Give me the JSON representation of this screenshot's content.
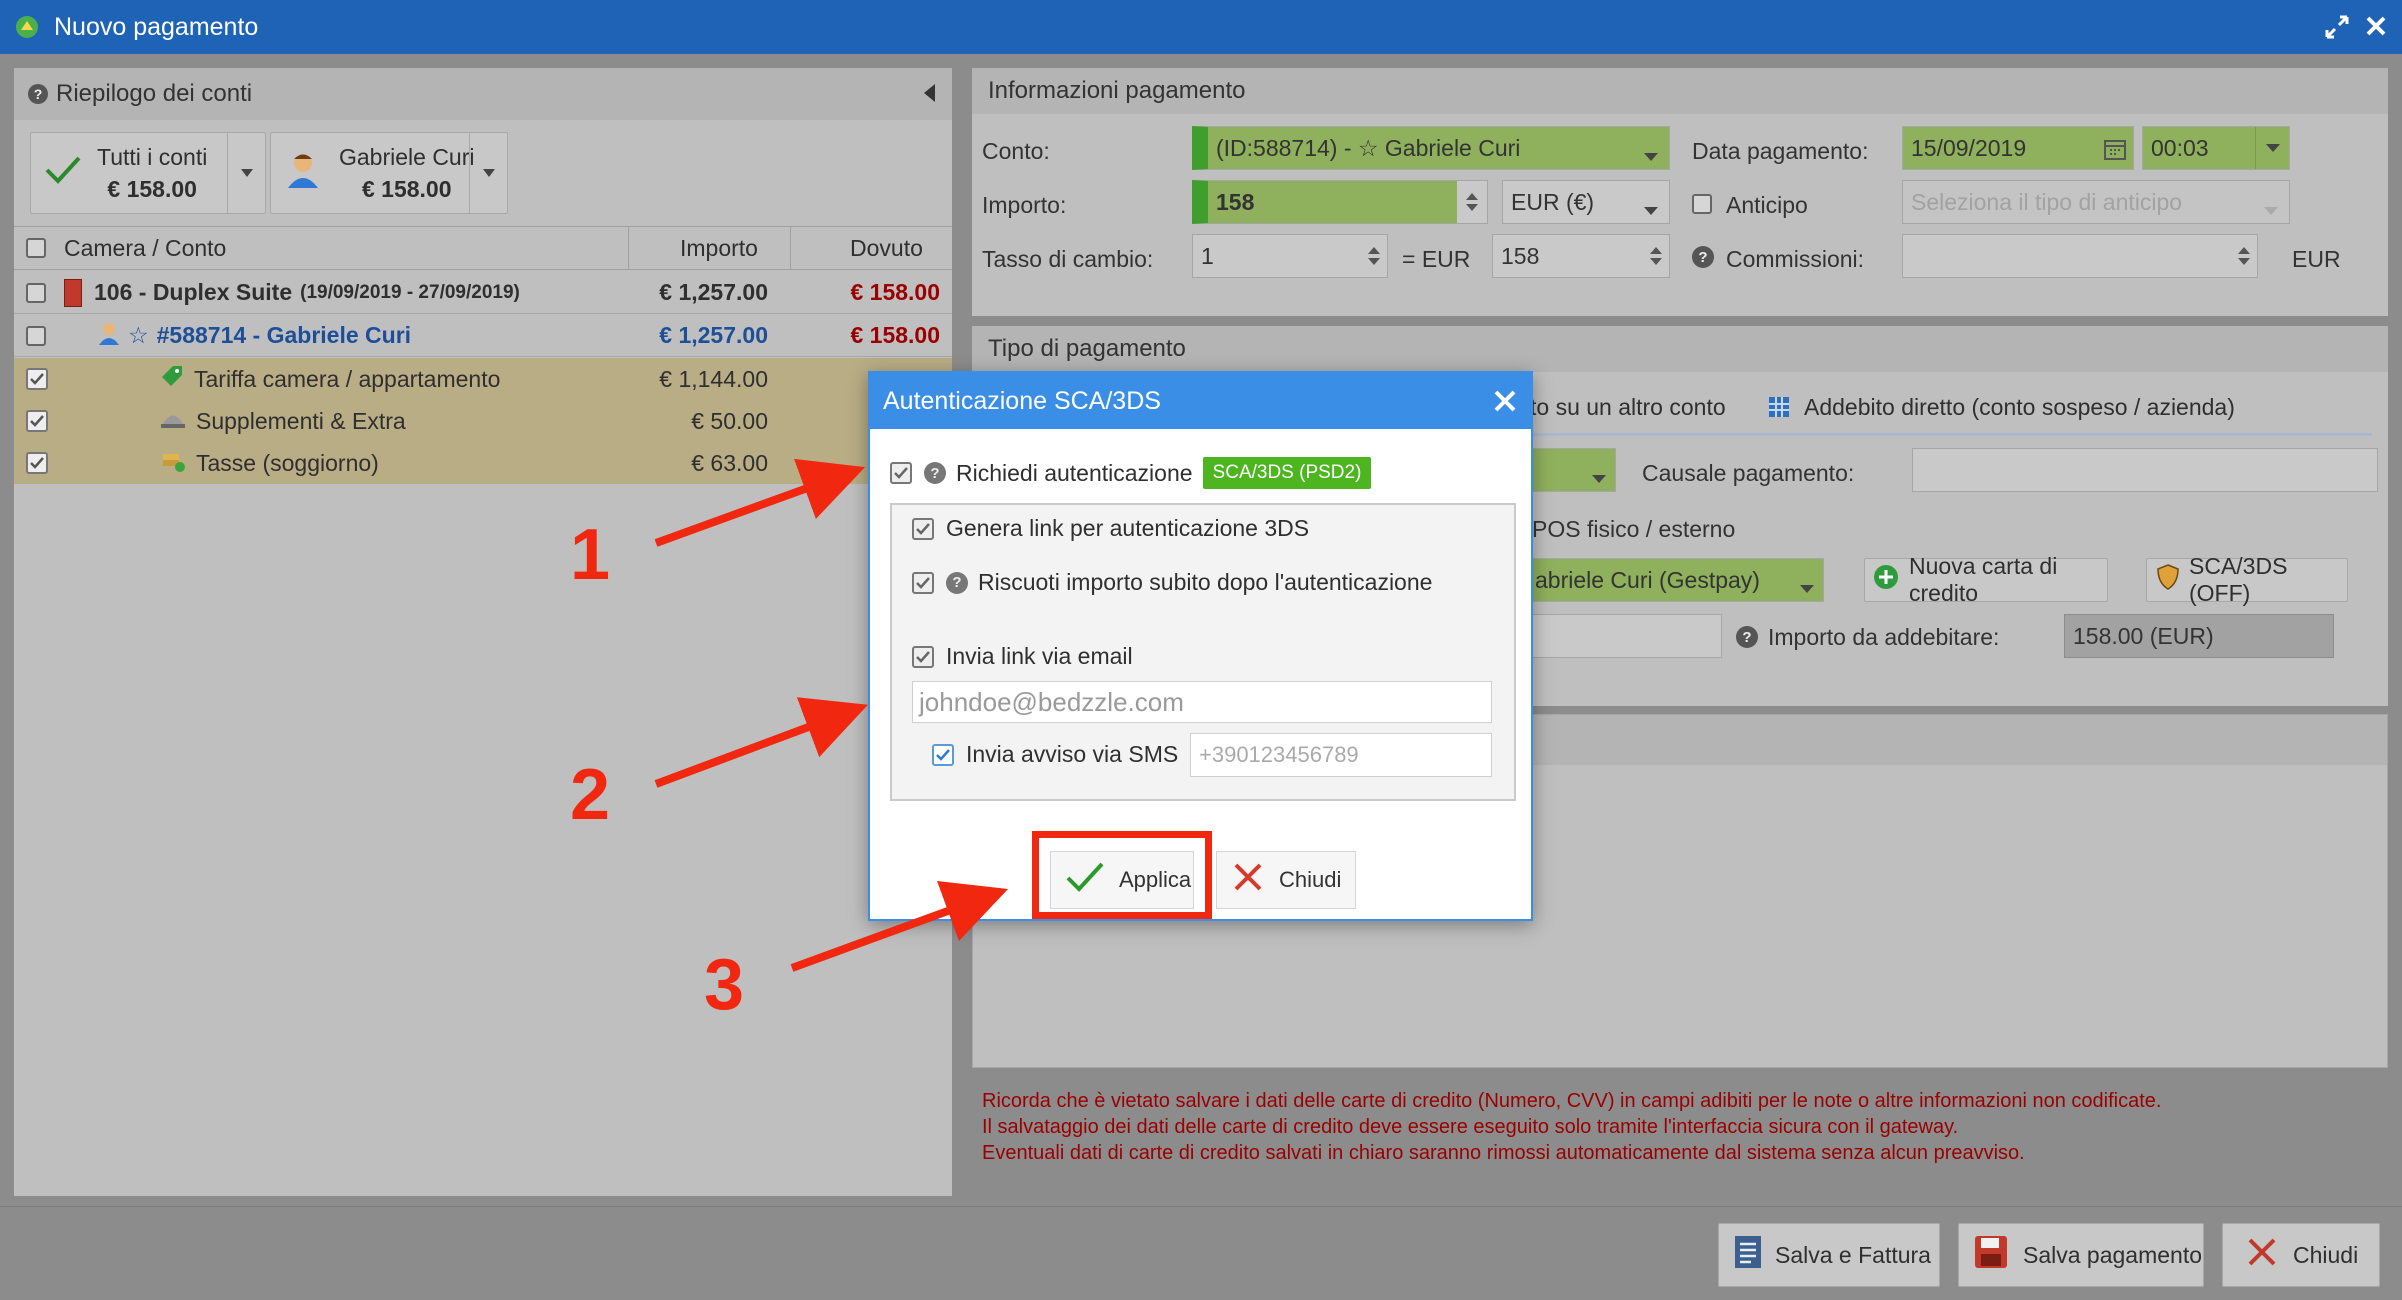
{
  "window": {
    "title": "Nuovo pagamento"
  },
  "summary": {
    "title": "Riepilogo dei conti",
    "all_accounts": {
      "label": "Tutti i conti",
      "amount": "€ 158.00"
    },
    "guest": {
      "label": "Gabriele Curi",
      "amount": "€ 158.00"
    },
    "columns": {
      "room": "Camera / Conto",
      "amount": "Importo",
      "due": "Dovuto"
    },
    "rows": [
      {
        "name": "106 - Duplex Suite",
        "dates": "(19/09/2019 - 27/09/2019)",
        "amount": "€ 1,257.00",
        "due": "€ 158.00"
      },
      {
        "name": "#588714 - Gabriele Curi",
        "amount": "€ 1,257.00",
        "due": "€ 158.00"
      },
      {
        "name": "Tariffa camera / appartamento",
        "amount": "€ 1,144.00"
      },
      {
        "name": "Supplementi & Extra",
        "amount": "€ 50.00"
      },
      {
        "name": "Tasse (soggiorno)",
        "amount": "€ 63.00"
      }
    ]
  },
  "payment_info": {
    "title": "Informazioni pagamento",
    "conto_label": "Conto:",
    "conto_value": "(ID:588714) - ☆ Gabriele Curi",
    "data_label": "Data pagamento:",
    "date_value": "15/09/2019",
    "time_value": "00:03",
    "importo_label": "Importo:",
    "importo_value": "158",
    "currency_value": "EUR (€)",
    "anticipo_label": "Anticipo",
    "anticipo_placeholder": "Seleziona il tipo di anticipo",
    "tasso_label": "Tasso di cambio:",
    "tasso_value": "1",
    "eq_eur": "= EUR",
    "converted_value": "158",
    "commissioni_label": "Commissioni:",
    "eur_suffix": "EUR"
  },
  "payment_type": {
    "title": "Tipo di pagamento",
    "tab_other_account": "to su un altro conto",
    "tab_direct_debit": "Addebito diretto (conto sospeso / azienda)",
    "causale_label": "Causale pagamento:",
    "pos_label": "POS fisico / esterno",
    "card_value": "abriele Curi (Gestpay)",
    "new_card_label": "Nuova carta di credito",
    "sca_off_label": "SCA/3DS (OFF)",
    "importo_addebitare_label": "Importo da addebitare:",
    "importo_addebitare_value": "158.00 (EUR)"
  },
  "warning": {
    "line1": "Ricorda che è vietato salvare i dati delle carte di credito (Numero, CVV) in campi adibiti per le note o altre informazioni non codificate.",
    "line2": "Il salvataggio dei dati delle carte di credito deve essere eseguito solo tramite l'interfaccia sicura con il gateway.",
    "line3": "Eventuali dati di carte di credito salvati in chiaro saranno rimossi automaticamente dal sistema senza alcun preavviso."
  },
  "footer": {
    "save_invoice": "Salva e Fattura",
    "save_payment": "Salva pagamento",
    "close": "Chiudi"
  },
  "modal": {
    "title": "Autenticazione SCA/3DS",
    "require_auth": "Richiedi autenticazione",
    "badge": "SCA/3DS (PSD2)",
    "gen_link": "Genera link per autenticazione 3DS",
    "collect_amount": "Riscuoti importo subito dopo l'autenticazione",
    "send_email": "Invia link via email",
    "email_value": "johndoe@bedzzle.com",
    "send_sms": "Invia avviso via SMS",
    "sms_placeholder": "+390123456789",
    "apply": "Applica",
    "close": "Chiudi"
  },
  "callouts": {
    "one": "1",
    "two": "2",
    "three": "3"
  },
  "colors": {
    "title_bar": "#1f63b6",
    "modal_header": "#3a8ee6",
    "badge_green": "#4cb51f",
    "callout_red": "#f2270f"
  }
}
